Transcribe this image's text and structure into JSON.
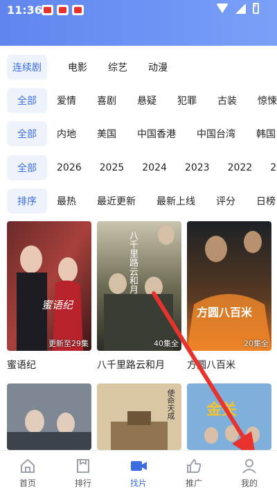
{
  "status": {
    "time": "11:36"
  },
  "filters": {
    "category": {
      "active": "连续剧",
      "options": [
        "电影",
        "综艺",
        "动漫"
      ]
    },
    "genre": {
      "active": "全部",
      "options": [
        "爱情",
        "喜剧",
        "悬疑",
        "犯罪",
        "古装",
        "惊悚"
      ]
    },
    "region": {
      "active": "全部",
      "options": [
        "内地",
        "美国",
        "中国香港",
        "中国台湾",
        "韩国"
      ]
    },
    "year": {
      "active": "全部",
      "options": [
        "2026",
        "2025",
        "2024",
        "2023",
        "2022",
        "2"
      ]
    },
    "sort": {
      "active": "排序",
      "options": [
        "最热",
        "最近更新",
        "最新上线",
        "评分",
        "日榜"
      ]
    }
  },
  "shows": [
    {
      "title": "蜜语纪",
      "episodes": "更新至29集",
      "poster_text": "蜜语纪"
    },
    {
      "title": "八千里路云和月",
      "episodes": "40集全",
      "poster_text": "八千里路云和月"
    },
    {
      "title": "方圆八百米",
      "episodes": "20集全",
      "poster_text": "方圆八百米"
    },
    {
      "title": "",
      "episodes": "",
      "poster_text": ""
    },
    {
      "title": "",
      "episodes": "",
      "poster_text": "使命天成"
    },
    {
      "title": "",
      "episodes": "",
      "poster_text": "金关"
    }
  ],
  "tabbar": [
    {
      "label": "首页",
      "icon": "home-icon"
    },
    {
      "label": "排行",
      "icon": "ranking-icon"
    },
    {
      "label": "找片",
      "icon": "video-icon",
      "active": true
    },
    {
      "label": "推广",
      "icon": "thumbs-up-icon"
    },
    {
      "label": "我的",
      "icon": "profile-icon"
    }
  ],
  "colors": {
    "accent": "#3b6de0",
    "header": "#6a90f2",
    "arrow": "#e8322e"
  }
}
